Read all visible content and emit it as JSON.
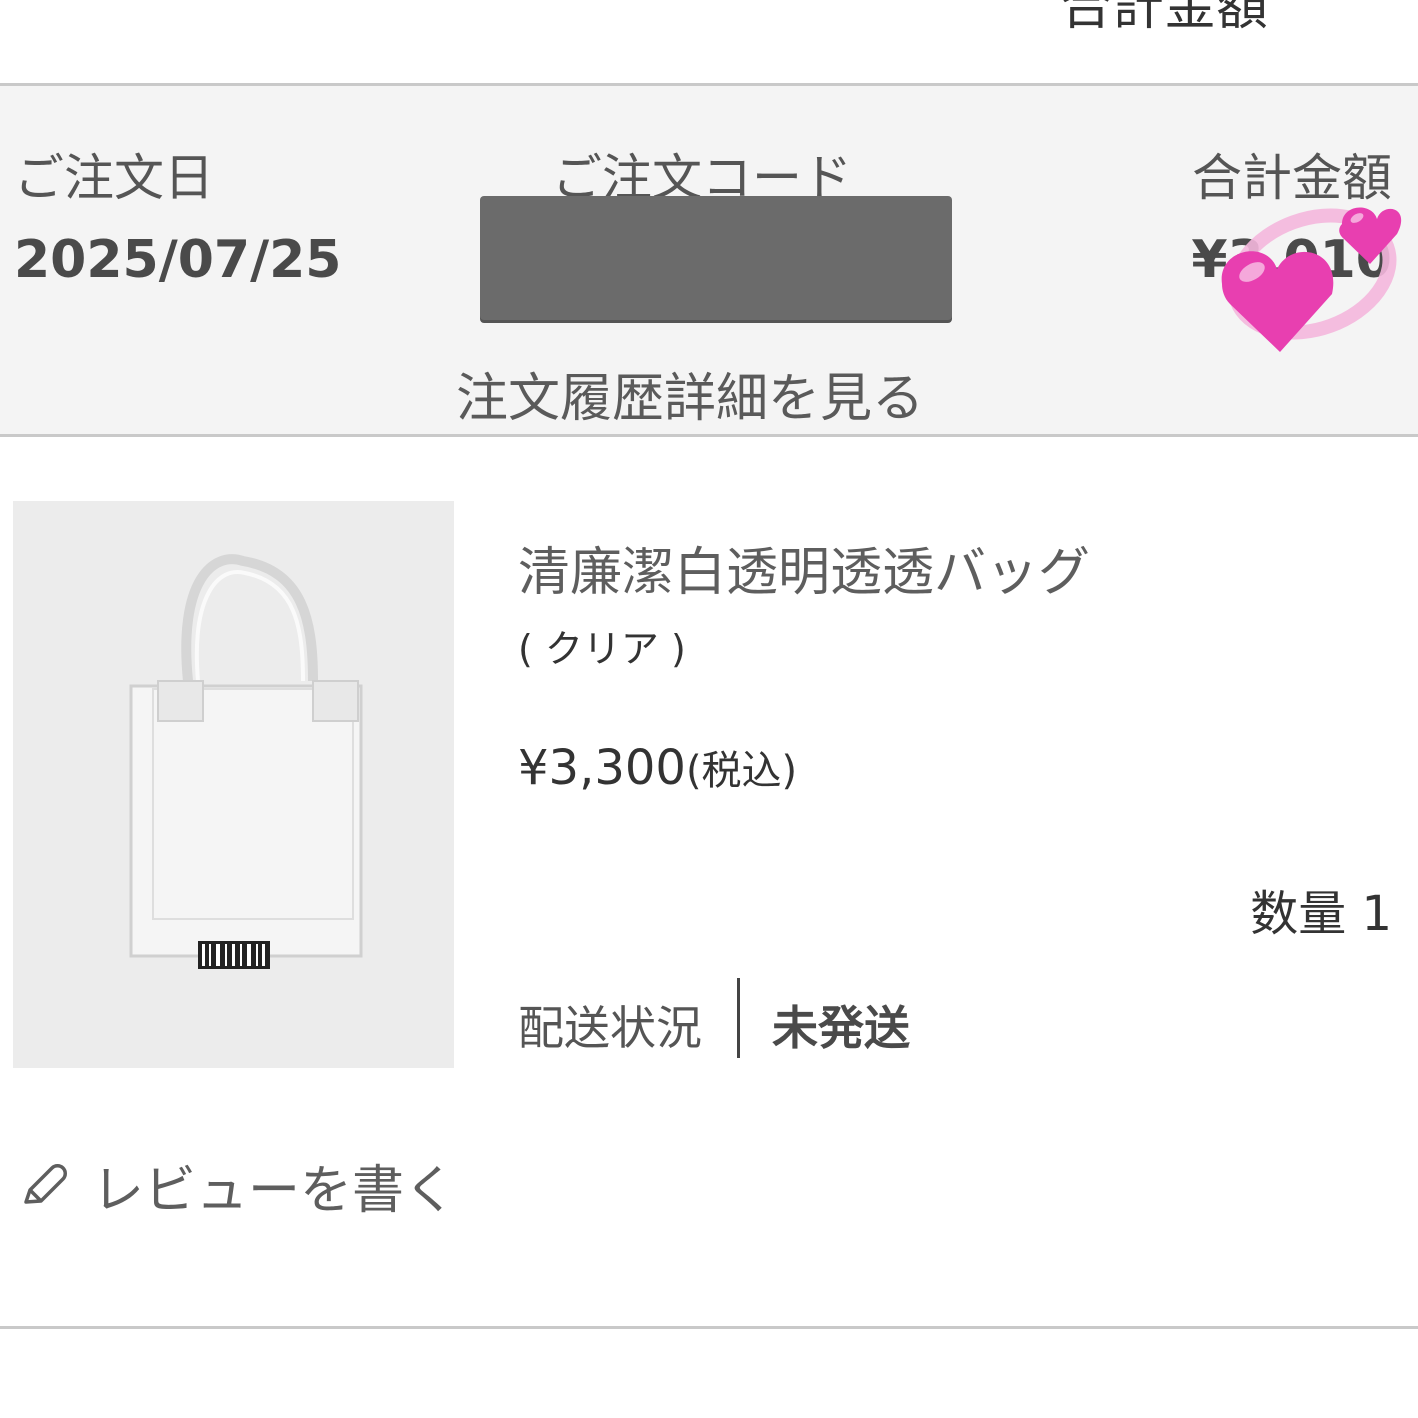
{
  "top_partial_text": "合計金額",
  "order_header": {
    "order_date_label": "ご注文日",
    "order_date_value": "2025/07/25",
    "order_code_label": "ご注文コード",
    "total_label": "合計金額",
    "total_value": "¥3,010",
    "detail_link": "注文履歴詳細を見る"
  },
  "product": {
    "name": "清廉潔白透明透透バッグ",
    "variant": "( クリア )",
    "price": "¥3,300",
    "tax_note": "(税込)",
    "quantity_label": "数量 1",
    "shipping_label": "配送状況",
    "shipping_status": "未発送"
  },
  "review": {
    "label": "レビューを書く",
    "icon": "pencil-icon"
  },
  "colors": {
    "header_bg": "#f4f4f4",
    "border": "#c9c9c9",
    "redaction": "#6b6b6b",
    "heart_pink": "#e83fb0"
  }
}
